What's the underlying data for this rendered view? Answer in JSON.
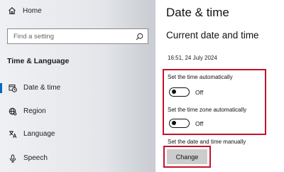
{
  "sidebar": {
    "home_label": "Home",
    "search": {
      "placeholder": "Find a setting",
      "icon": "search-icon"
    },
    "section_heading": "Time & Language",
    "items": [
      {
        "label": "Date & time",
        "icon": "date-time-icon",
        "selected": true
      },
      {
        "label": "Region",
        "icon": "globe-gear-icon",
        "selected": false
      },
      {
        "label": "Language",
        "icon": "language-icon",
        "selected": false
      },
      {
        "label": "Speech",
        "icon": "microphone-icon",
        "selected": false
      }
    ]
  },
  "main": {
    "title": "Date & time",
    "subtitle": "Current date and time",
    "current_datetime": "16:51, 24 July 2024",
    "settings": [
      {
        "label": "Set the time automatically",
        "state": "Off"
      },
      {
        "label": "Set the time zone automatically",
        "state": "Off"
      }
    ],
    "manual": {
      "label": "Set the date and time manually",
      "button_label": "Change"
    }
  },
  "colors": {
    "accent": "#0067c0",
    "highlight": "#c8102e",
    "button_bg": "#cccccc"
  }
}
